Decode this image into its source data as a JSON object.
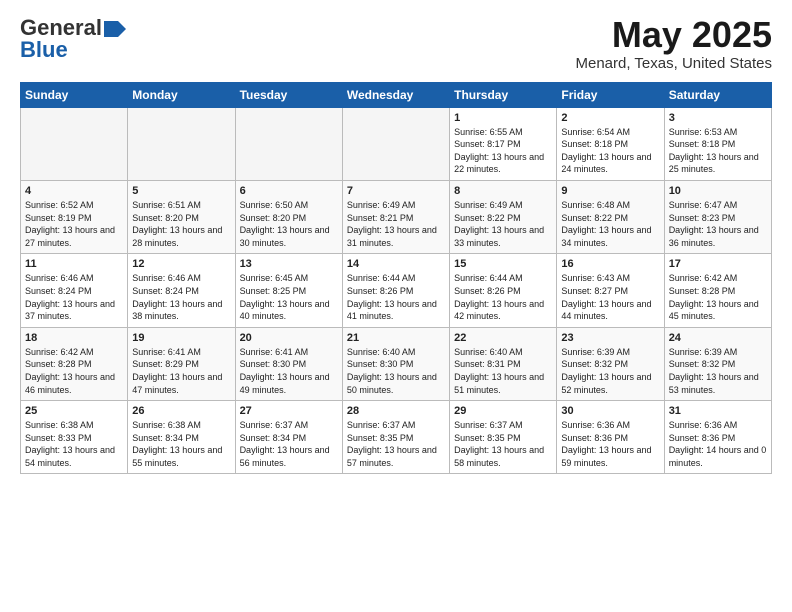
{
  "header": {
    "logo_general": "General",
    "logo_blue": "Blue",
    "month_title": "May 2025",
    "location": "Menard, Texas, United States"
  },
  "weekdays": [
    "Sunday",
    "Monday",
    "Tuesday",
    "Wednesday",
    "Thursday",
    "Friday",
    "Saturday"
  ],
  "weeks": [
    [
      {
        "day": "",
        "empty": true
      },
      {
        "day": "",
        "empty": true
      },
      {
        "day": "",
        "empty": true
      },
      {
        "day": "",
        "empty": true
      },
      {
        "day": "1",
        "sunrise": "6:55 AM",
        "sunset": "8:17 PM",
        "daylight": "13 hours and 22 minutes."
      },
      {
        "day": "2",
        "sunrise": "6:54 AM",
        "sunset": "8:18 PM",
        "daylight": "13 hours and 24 minutes."
      },
      {
        "day": "3",
        "sunrise": "6:53 AM",
        "sunset": "8:18 PM",
        "daylight": "13 hours and 25 minutes."
      }
    ],
    [
      {
        "day": "4",
        "sunrise": "6:52 AM",
        "sunset": "8:19 PM",
        "daylight": "13 hours and 27 minutes."
      },
      {
        "day": "5",
        "sunrise": "6:51 AM",
        "sunset": "8:20 PM",
        "daylight": "13 hours and 28 minutes."
      },
      {
        "day": "6",
        "sunrise": "6:50 AM",
        "sunset": "8:20 PM",
        "daylight": "13 hours and 30 minutes."
      },
      {
        "day": "7",
        "sunrise": "6:49 AM",
        "sunset": "8:21 PM",
        "daylight": "13 hours and 31 minutes."
      },
      {
        "day": "8",
        "sunrise": "6:49 AM",
        "sunset": "8:22 PM",
        "daylight": "13 hours and 33 minutes."
      },
      {
        "day": "9",
        "sunrise": "6:48 AM",
        "sunset": "8:22 PM",
        "daylight": "13 hours and 34 minutes."
      },
      {
        "day": "10",
        "sunrise": "6:47 AM",
        "sunset": "8:23 PM",
        "daylight": "13 hours and 36 minutes."
      }
    ],
    [
      {
        "day": "11",
        "sunrise": "6:46 AM",
        "sunset": "8:24 PM",
        "daylight": "13 hours and 37 minutes."
      },
      {
        "day": "12",
        "sunrise": "6:46 AM",
        "sunset": "8:24 PM",
        "daylight": "13 hours and 38 minutes."
      },
      {
        "day": "13",
        "sunrise": "6:45 AM",
        "sunset": "8:25 PM",
        "daylight": "13 hours and 40 minutes."
      },
      {
        "day": "14",
        "sunrise": "6:44 AM",
        "sunset": "8:26 PM",
        "daylight": "13 hours and 41 minutes."
      },
      {
        "day": "15",
        "sunrise": "6:44 AM",
        "sunset": "8:26 PM",
        "daylight": "13 hours and 42 minutes."
      },
      {
        "day": "16",
        "sunrise": "6:43 AM",
        "sunset": "8:27 PM",
        "daylight": "13 hours and 44 minutes."
      },
      {
        "day": "17",
        "sunrise": "6:42 AM",
        "sunset": "8:28 PM",
        "daylight": "13 hours and 45 minutes."
      }
    ],
    [
      {
        "day": "18",
        "sunrise": "6:42 AM",
        "sunset": "8:28 PM",
        "daylight": "13 hours and 46 minutes."
      },
      {
        "day": "19",
        "sunrise": "6:41 AM",
        "sunset": "8:29 PM",
        "daylight": "13 hours and 47 minutes."
      },
      {
        "day": "20",
        "sunrise": "6:41 AM",
        "sunset": "8:30 PM",
        "daylight": "13 hours and 49 minutes."
      },
      {
        "day": "21",
        "sunrise": "6:40 AM",
        "sunset": "8:30 PM",
        "daylight": "13 hours and 50 minutes."
      },
      {
        "day": "22",
        "sunrise": "6:40 AM",
        "sunset": "8:31 PM",
        "daylight": "13 hours and 51 minutes."
      },
      {
        "day": "23",
        "sunrise": "6:39 AM",
        "sunset": "8:32 PM",
        "daylight": "13 hours and 52 minutes."
      },
      {
        "day": "24",
        "sunrise": "6:39 AM",
        "sunset": "8:32 PM",
        "daylight": "13 hours and 53 minutes."
      }
    ],
    [
      {
        "day": "25",
        "sunrise": "6:38 AM",
        "sunset": "8:33 PM",
        "daylight": "13 hours and 54 minutes."
      },
      {
        "day": "26",
        "sunrise": "6:38 AM",
        "sunset": "8:34 PM",
        "daylight": "13 hours and 55 minutes."
      },
      {
        "day": "27",
        "sunrise": "6:37 AM",
        "sunset": "8:34 PM",
        "daylight": "13 hours and 56 minutes."
      },
      {
        "day": "28",
        "sunrise": "6:37 AM",
        "sunset": "8:35 PM",
        "daylight": "13 hours and 57 minutes."
      },
      {
        "day": "29",
        "sunrise": "6:37 AM",
        "sunset": "8:35 PM",
        "daylight": "13 hours and 58 minutes."
      },
      {
        "day": "30",
        "sunrise": "6:36 AM",
        "sunset": "8:36 PM",
        "daylight": "13 hours and 59 minutes."
      },
      {
        "day": "31",
        "sunrise": "6:36 AM",
        "sunset": "8:36 PM",
        "daylight": "14 hours and 0 minutes."
      }
    ]
  ]
}
